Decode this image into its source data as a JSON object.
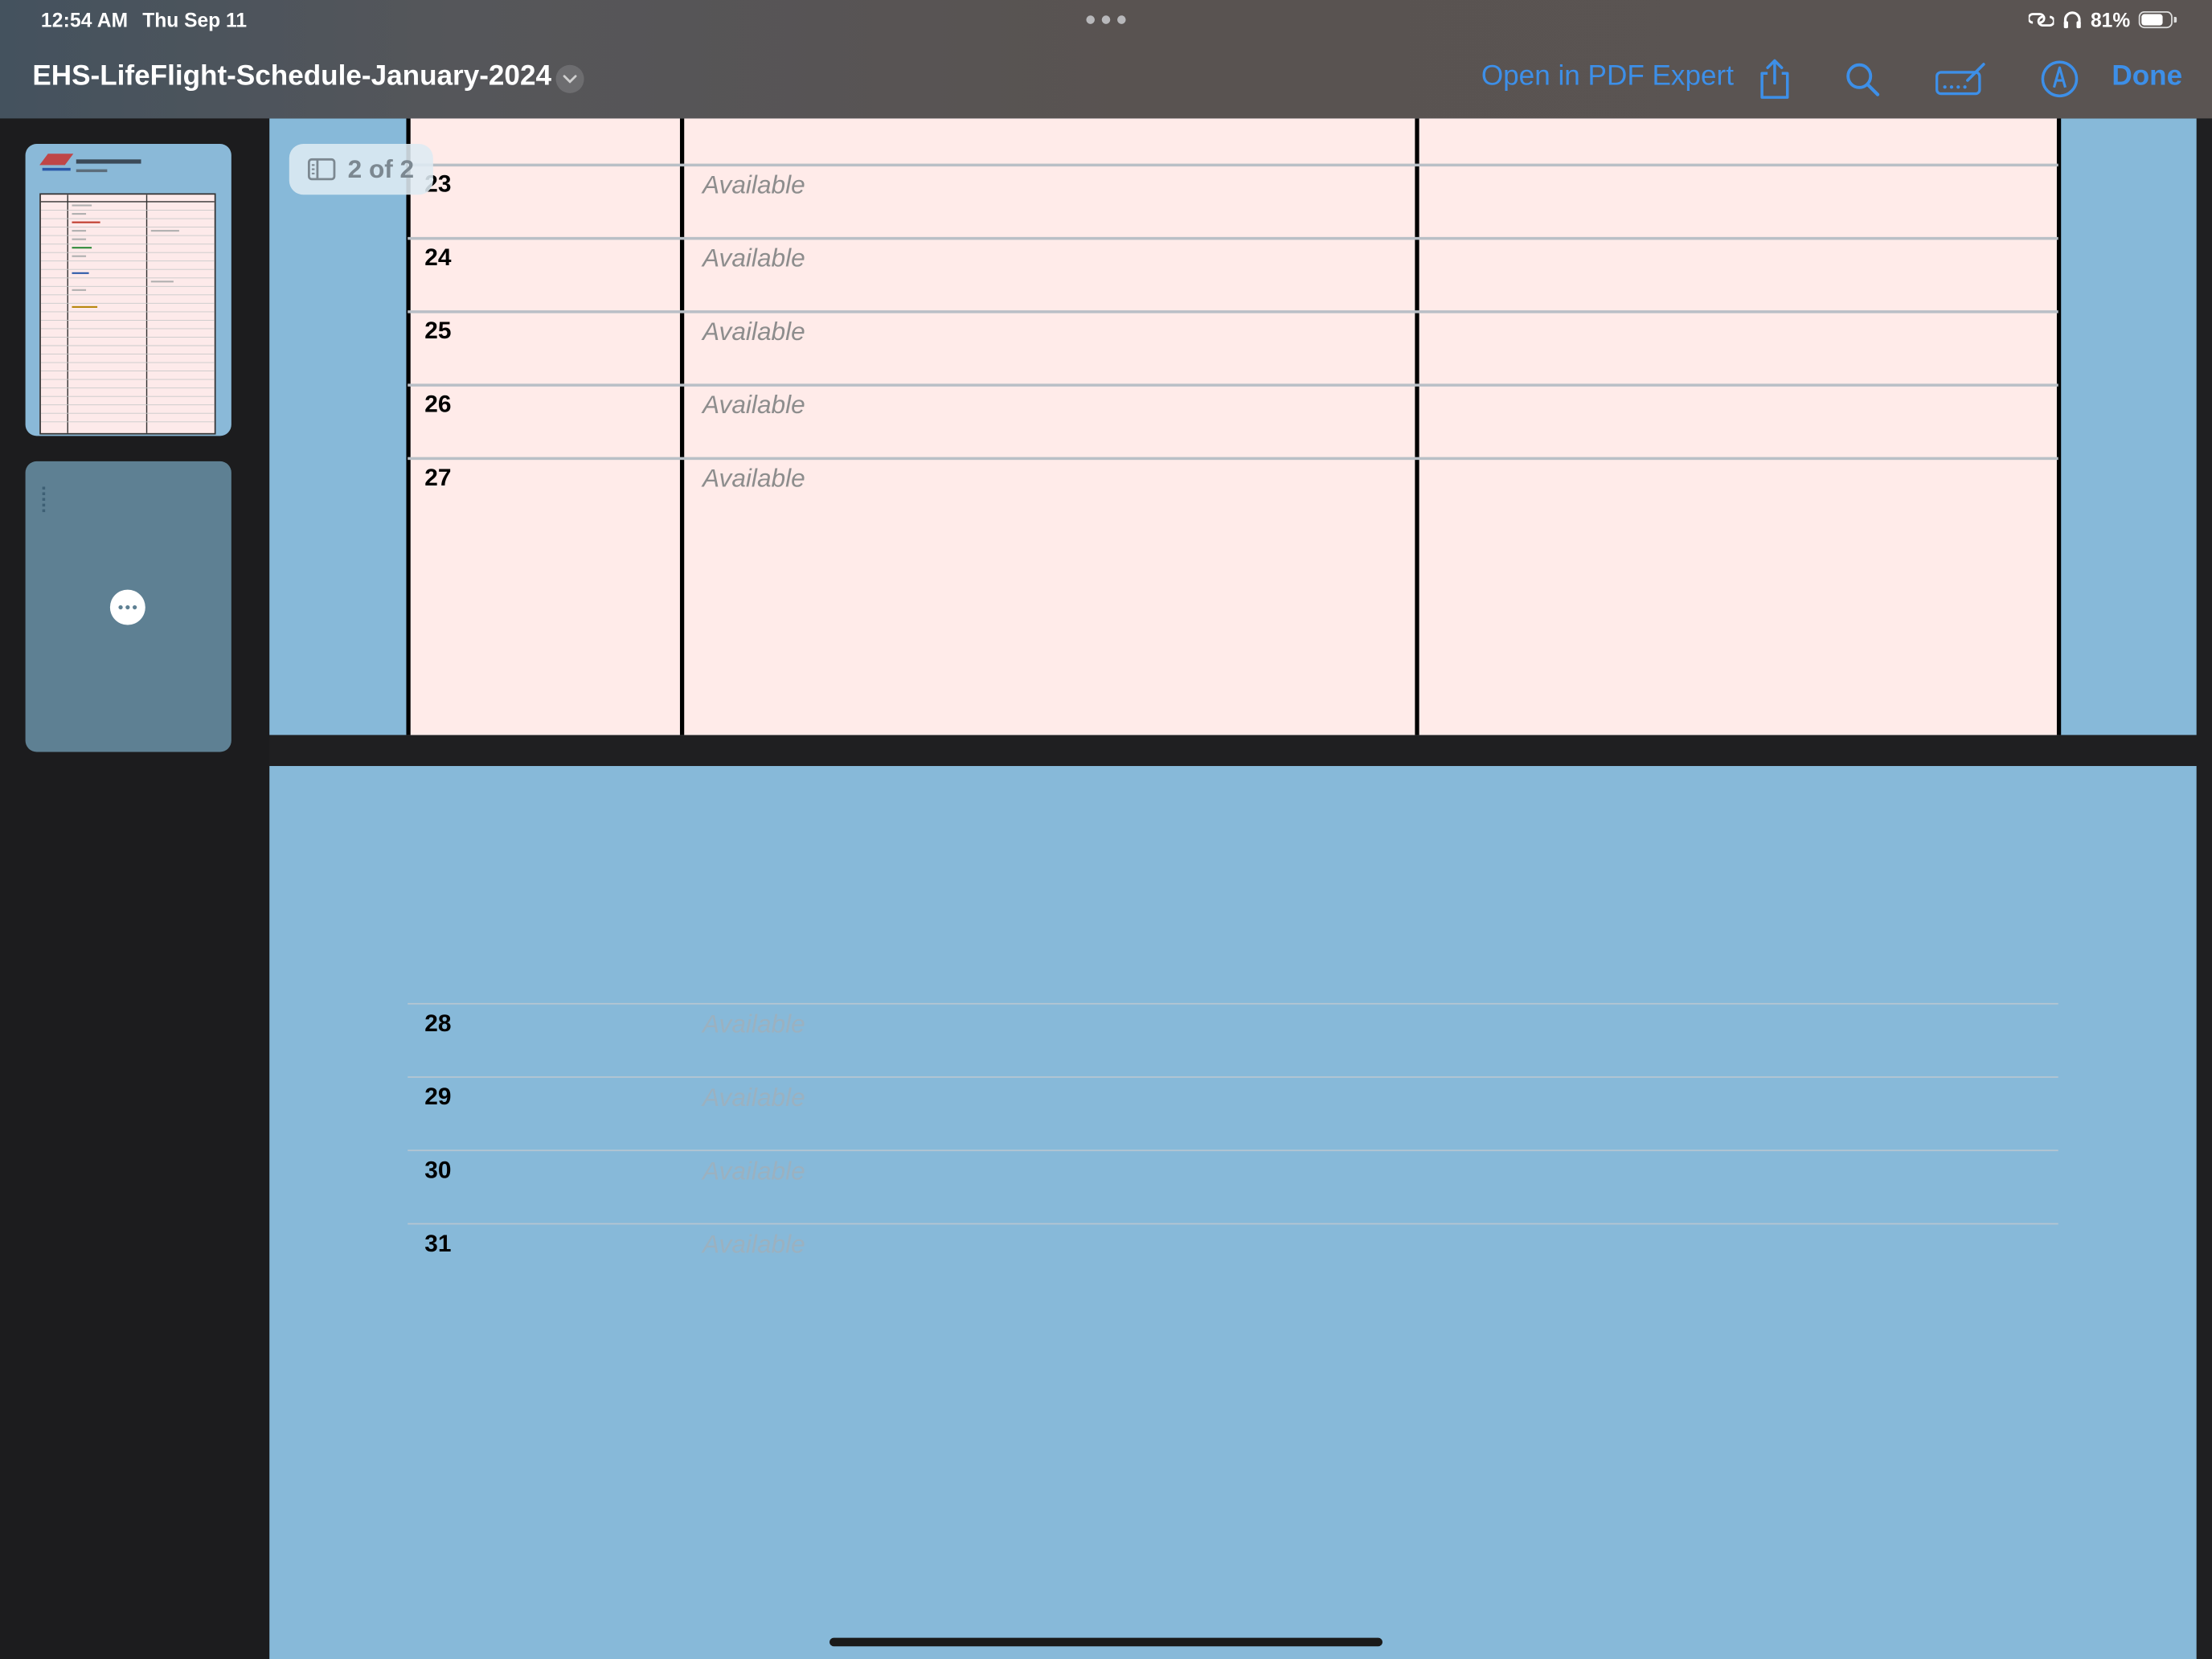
{
  "status_bar": {
    "time": "12:54 AM",
    "date": "Thu Sep 11",
    "battery_text": "81%",
    "battery_level": 0.81
  },
  "toolbar": {
    "document_title": "EHS-LifeFlight-Schedule-January-2024",
    "open_in_label": "Open in PDF Expert",
    "done_label": "Done",
    "icons": [
      "share-icon",
      "search-icon",
      "annotate-icon",
      "markup-icon",
      "chevron-down-icon"
    ]
  },
  "page_indicator": {
    "label": "2 of 2"
  },
  "page1_rows": [
    {
      "day": "23",
      "status": "Available"
    },
    {
      "day": "24",
      "status": "Available"
    },
    {
      "day": "25",
      "status": "Available"
    },
    {
      "day": "26",
      "status": "Available"
    },
    {
      "day": "27",
      "status": "Available"
    }
  ],
  "page2_rows": [
    {
      "day": "28",
      "status": "Available"
    },
    {
      "day": "29",
      "status": "Available"
    },
    {
      "day": "30",
      "status": "Available"
    },
    {
      "day": "31",
      "status": "Available"
    }
  ],
  "colors": {
    "accent": "#3d8fe8",
    "page_background": "#87b9d9",
    "table_background": "#ffebe9"
  }
}
